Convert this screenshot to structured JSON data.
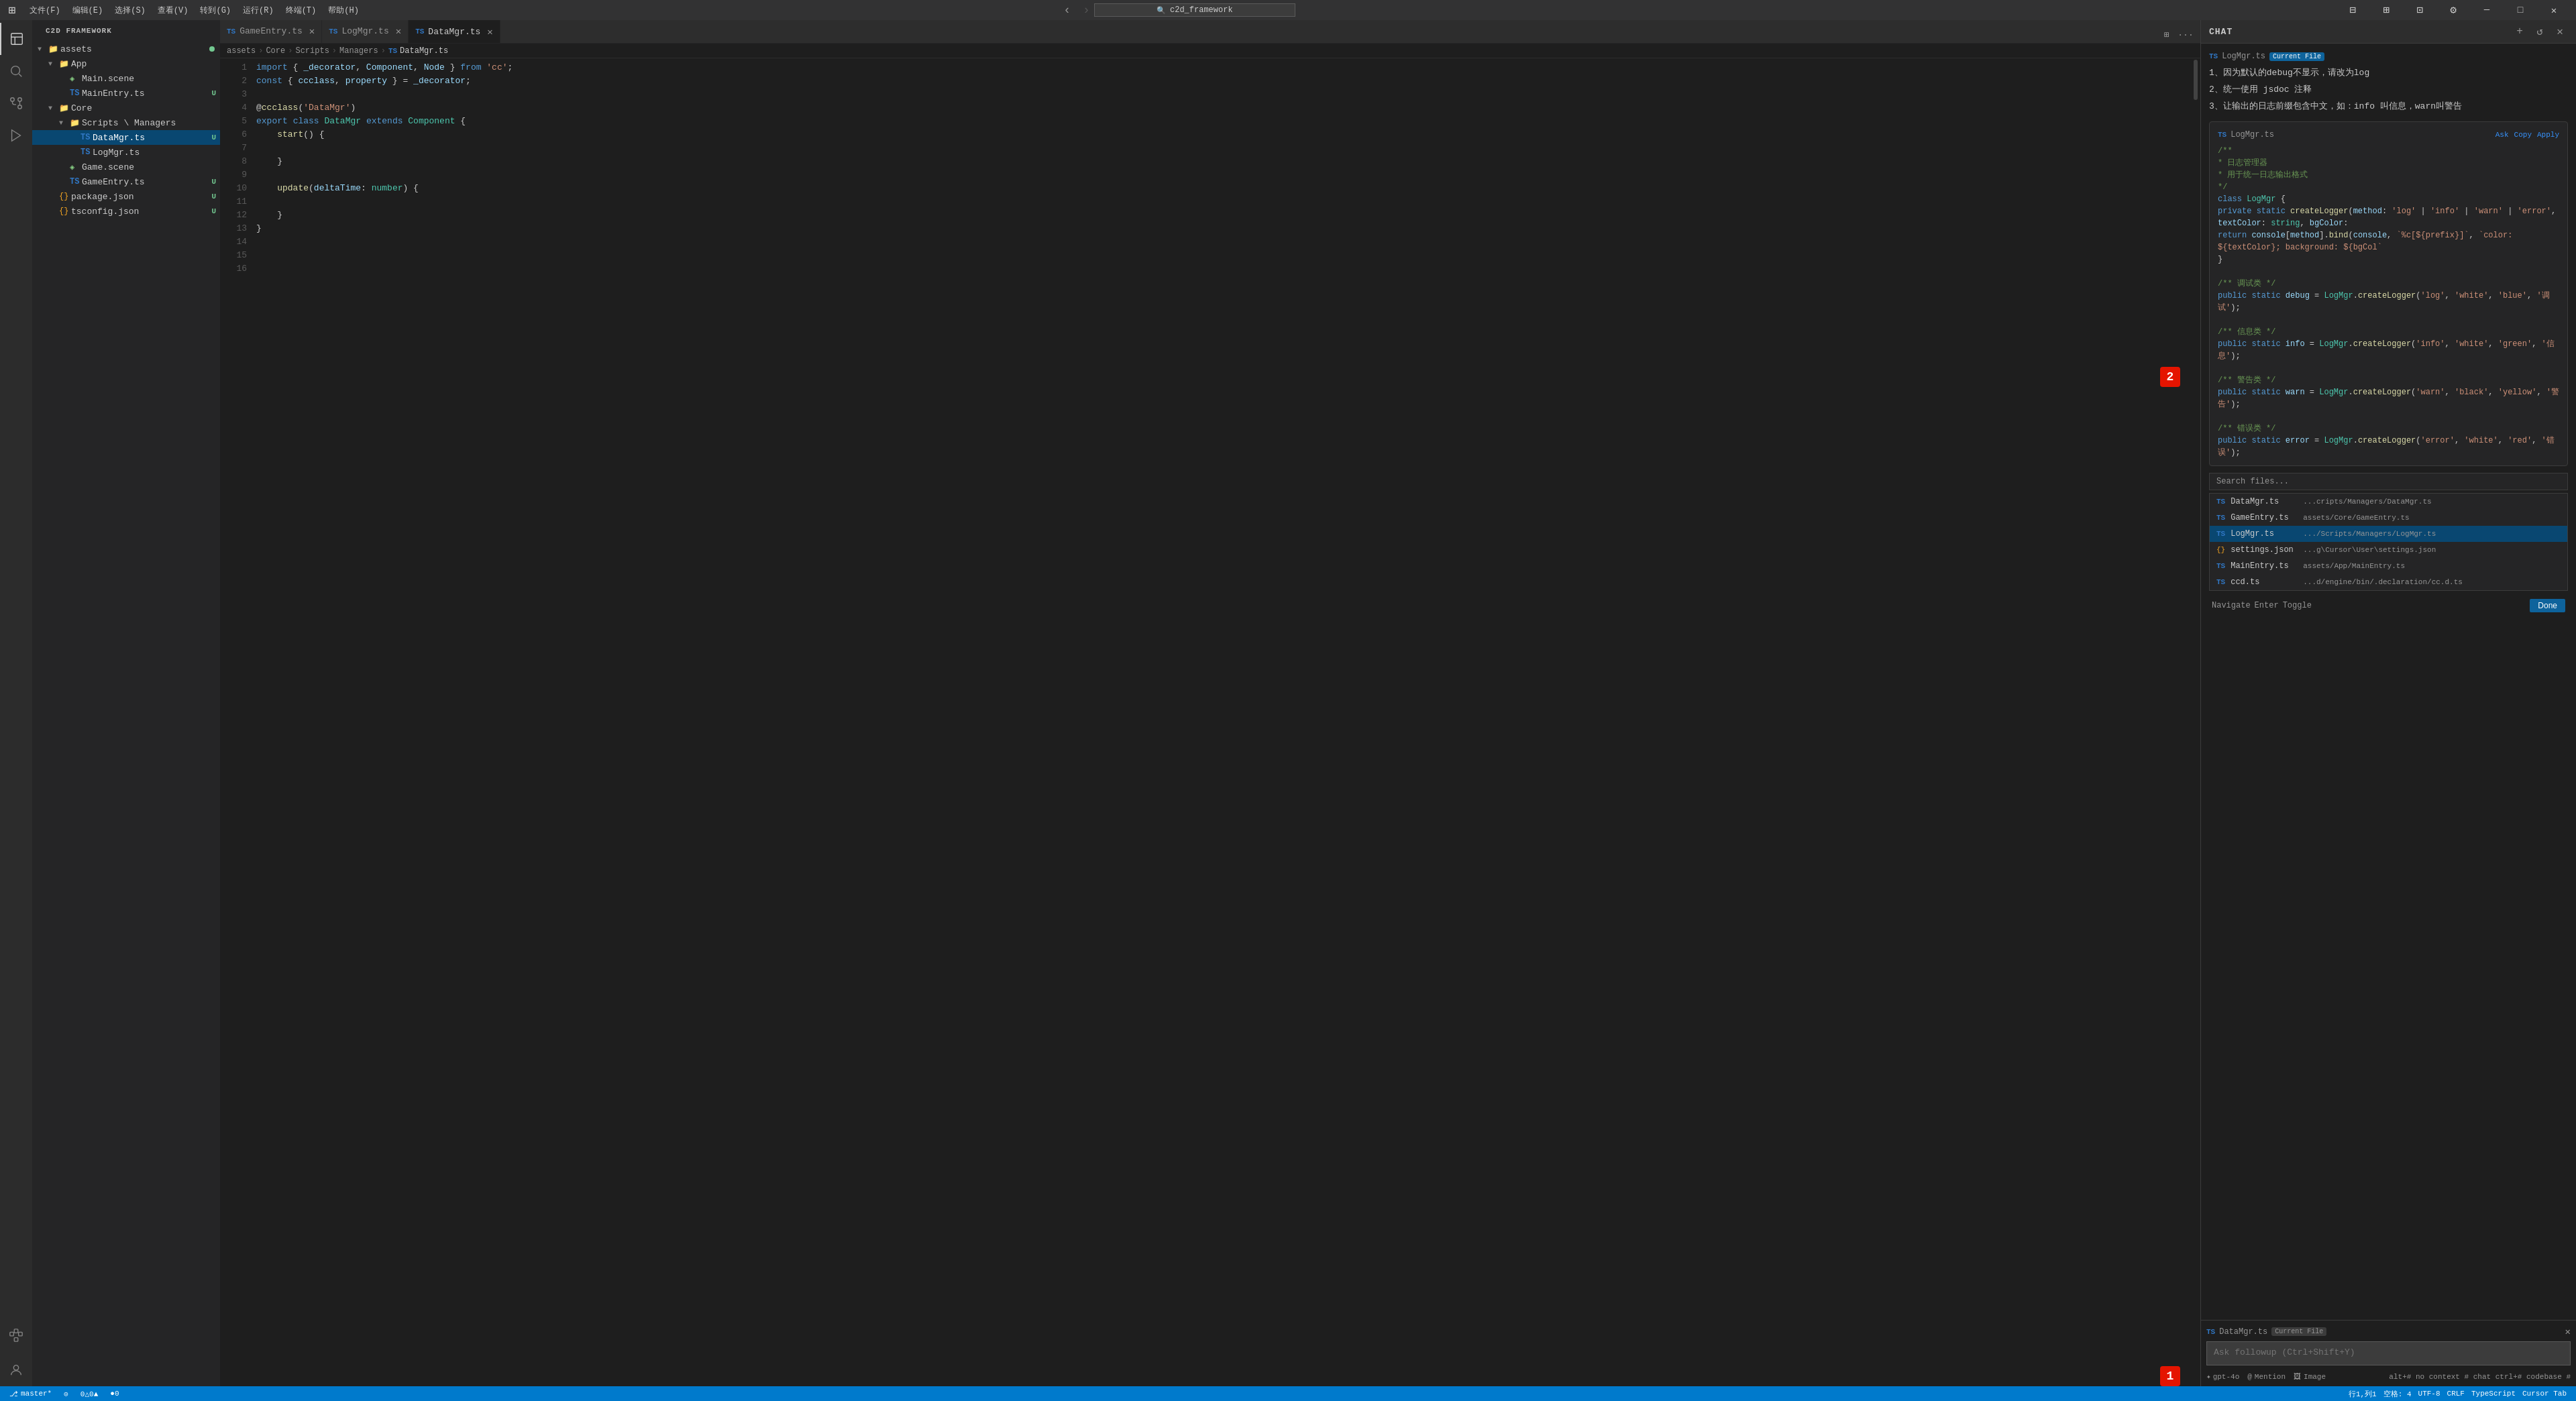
{
  "titlebar": {
    "menu_items": [
      "文件(F)",
      "编辑(E)",
      "选择(S)",
      "查看(V)",
      "转到(G)",
      "运行(R)",
      "终端(T)",
      "帮助(H)"
    ],
    "search_placeholder": "c2d_framework",
    "back_icon": "‹",
    "forward_icon": "›"
  },
  "tabs": [
    {
      "id": "gameentry",
      "icon": "TS",
      "label": "GameEntry.ts",
      "active": false,
      "dirty": false
    },
    {
      "id": "logmgr",
      "icon": "TS",
      "label": "LogMgr.ts",
      "active": false,
      "dirty": false
    },
    {
      "id": "datamgr",
      "icon": "TS",
      "label": "DataMgr.ts",
      "active": true,
      "dirty": false
    }
  ],
  "breadcrumb": {
    "parts": [
      "assets",
      "Core",
      "Scripts",
      "Managers",
      "DataMgr.ts"
    ]
  },
  "editor": {
    "filename": "DataMgr.ts",
    "lines": [
      {
        "num": 1,
        "content": "import { _decorator, Component, Node } from 'cc';"
      },
      {
        "num": 2,
        "content": "const { ccclass, property } = _decorator;"
      },
      {
        "num": 3,
        "content": ""
      },
      {
        "num": 4,
        "content": "@ccclass('DataMgr')"
      },
      {
        "num": 5,
        "content": "export class DataMgr extends Component {"
      },
      {
        "num": 6,
        "content": "    start() {"
      },
      {
        "num": 7,
        "content": ""
      },
      {
        "num": 8,
        "content": "    }"
      },
      {
        "num": 9,
        "content": ""
      },
      {
        "num": 10,
        "content": "    update(deltaTime: number) {"
      },
      {
        "num": 11,
        "content": ""
      },
      {
        "num": 12,
        "content": "    }"
      },
      {
        "num": 13,
        "content": "}"
      },
      {
        "num": 14,
        "content": ""
      },
      {
        "num": 15,
        "content": ""
      },
      {
        "num": 16,
        "content": ""
      }
    ]
  },
  "sidebar": {
    "title": "C2D FRAMEWORK",
    "tree": [
      {
        "id": "assets",
        "label": "assets",
        "type": "folder",
        "expanded": true,
        "level": 0,
        "badge": ""
      },
      {
        "id": "app",
        "label": "App",
        "type": "folder",
        "expanded": true,
        "level": 1,
        "badge": ""
      },
      {
        "id": "mainscene",
        "label": "Main.scene",
        "type": "scene",
        "level": 2,
        "badge": ""
      },
      {
        "id": "mainentry",
        "label": "MainEntry.ts",
        "type": "ts",
        "level": 2,
        "badge": "U"
      },
      {
        "id": "core",
        "label": "Core",
        "type": "folder",
        "expanded": true,
        "level": 1,
        "badge": ""
      },
      {
        "id": "scripts-managers",
        "label": "Scripts \\ Managers",
        "type": "folder",
        "expanded": true,
        "level": 2,
        "badge": ""
      },
      {
        "id": "datamgr",
        "label": "DataMgr.ts",
        "type": "ts",
        "level": 3,
        "badge": "U",
        "active": true
      },
      {
        "id": "logmgr",
        "label": "LogMgr.ts",
        "type": "ts",
        "level": 3,
        "badge": ""
      },
      {
        "id": "gamescene",
        "label": "Game.scene",
        "type": "scene",
        "level": 2,
        "badge": ""
      },
      {
        "id": "gameentry",
        "label": "GameEntry.ts",
        "type": "ts",
        "level": 2,
        "badge": "U"
      },
      {
        "id": "package-json",
        "label": "package.json",
        "type": "json",
        "level": 1,
        "badge": "U"
      },
      {
        "id": "tsconfig-json",
        "label": "tsconfig.json",
        "type": "json",
        "level": 1,
        "badge": "U"
      }
    ]
  },
  "chat": {
    "title": "CHAT",
    "file_ref": "LogMgr.ts",
    "current_file_badge": "Current File",
    "notes": [
      "1、因为默认的debug不显示，请改为log",
      "2、统一使用 jsdoc 注释",
      "3、让输出的日志前缀包含中文，如：info 叫信息，warn叫警告"
    ],
    "code_block": {
      "filename": "LogMgr.ts",
      "actions": [
        "Ask",
        "Copy",
        "Apply"
      ],
      "lines": [
        "/**",
        " * 日志管理器",
        " * 用于统一日志输出格式",
        " */",
        "class LogMgr {",
        "    private static createLogger(method: 'log' | 'info' | 'warn' | 'error', textColor: string, bgColor:",
        "        return console[method].bind(console, `%c[${prefix}]`, `color: ${textColor}; background: ${bgCol",
        "    }",
        "",
        "    /** 调试类 */",
        "    public static debug = LogMgr.createLogger('log', 'white', 'blue', '调试');",
        "",
        "    /** 信息类 */",
        "    public static info = LogMgr.createLogger('info', 'white', 'green', '信息');",
        "",
        "    /** 警告类 */",
        "    public static warn = LogMgr.createLogger('warn', 'black', 'yellow', '警告');",
        "",
        "    /** 错误类 */",
        "    public static error = LogMgr.createLogger('error', 'white', 'red', '错误');"
      ]
    },
    "search_placeholder": "Search files...",
    "search_results": [
      {
        "icon": "TS",
        "name": "DataMgr.ts",
        "path": "...cripts/Managers/DataMgr.ts"
      },
      {
        "icon": "TS",
        "name": "GameEntry.ts",
        "path": "assets/Core/GameEntry.ts"
      },
      {
        "icon": "TS",
        "name": "LogMgr.ts",
        "path": ".../Scripts/Managers/LogMgr.ts",
        "highlighted": true
      },
      {
        "icon": "{}",
        "name": "settings.json",
        "path": "...g\\Cursor\\User\\settings.json"
      },
      {
        "icon": "TS",
        "name": "MainEntry.ts",
        "path": "assets/App/MainEntry.ts"
      },
      {
        "icon": "TS",
        "name": "ccd.ts",
        "path": "...d/engine/bin/.declaration/cc.d.ts"
      }
    ],
    "nav_buttons": [
      "Navigate",
      "Enter",
      "Toggle"
    ],
    "done_label": "Done",
    "input": {
      "placeholder": "Ask followup (Ctrl+Shift+Y)",
      "current_file": "DataMgr.ts",
      "current_file_badge": "Current File",
      "model": "gpt-4o",
      "options": [
        "Mention",
        "Image"
      ],
      "keybind": "alt+# no context  # chat  ctrl+# codebase #"
    }
  },
  "status_bar": {
    "left": [
      "master*",
      "⊙",
      "0△0▲",
      "●0"
    ],
    "right": [
      "行1,列1",
      "空格: 4",
      "UTF-8",
      "CRLF",
      "TypeScript",
      "Cursor Tab"
    ]
  },
  "red_badges": {
    "badge1": "1",
    "badge2": "2"
  }
}
